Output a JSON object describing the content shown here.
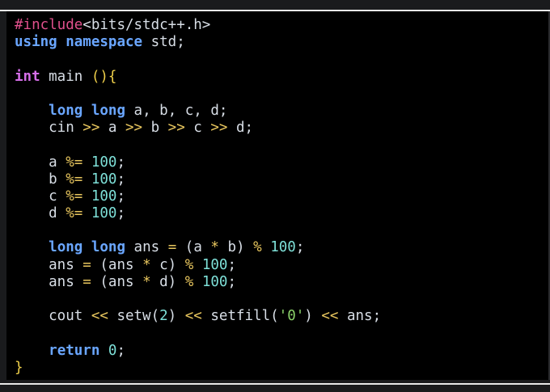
{
  "editor": {
    "lines": [
      [
        {
          "t": "#include",
          "c": "pre"
        },
        {
          "t": "<bits/stdc++.h>",
          "c": "id"
        }
      ],
      [
        {
          "t": "using",
          "c": "kw"
        },
        {
          "t": " ",
          "c": "id"
        },
        {
          "t": "namespace",
          "c": "kw"
        },
        {
          "t": " std;",
          "c": "id"
        }
      ],
      [],
      [
        {
          "t": "int",
          "c": "type"
        },
        {
          "t": " main ",
          "c": "id"
        },
        {
          "t": "(){",
          "c": "bracket"
        }
      ],
      [],
      [
        {
          "t": "    ",
          "c": "id"
        },
        {
          "t": "long",
          "c": "kw"
        },
        {
          "t": " ",
          "c": "id"
        },
        {
          "t": "long",
          "c": "kw"
        },
        {
          "t": " a, b, c, d;",
          "c": "id"
        }
      ],
      [
        {
          "t": "    cin ",
          "c": "id"
        },
        {
          "t": ">>",
          "c": "op"
        },
        {
          "t": " a ",
          "c": "id"
        },
        {
          "t": ">>",
          "c": "op"
        },
        {
          "t": " b ",
          "c": "id"
        },
        {
          "t": ">>",
          "c": "op"
        },
        {
          "t": " c ",
          "c": "id"
        },
        {
          "t": ">>",
          "c": "op"
        },
        {
          "t": " d;",
          "c": "id"
        }
      ],
      [],
      [
        {
          "t": "    a ",
          "c": "id"
        },
        {
          "t": "%=",
          "c": "op"
        },
        {
          "t": " ",
          "c": "id"
        },
        {
          "t": "100",
          "c": "num"
        },
        {
          "t": ";",
          "c": "id"
        }
      ],
      [
        {
          "t": "    b ",
          "c": "id"
        },
        {
          "t": "%=",
          "c": "op"
        },
        {
          "t": " ",
          "c": "id"
        },
        {
          "t": "100",
          "c": "num"
        },
        {
          "t": ";",
          "c": "id"
        }
      ],
      [
        {
          "t": "    c ",
          "c": "id"
        },
        {
          "t": "%=",
          "c": "op"
        },
        {
          "t": " ",
          "c": "id"
        },
        {
          "t": "100",
          "c": "num"
        },
        {
          "t": ";",
          "c": "id"
        }
      ],
      [
        {
          "t": "    d ",
          "c": "id"
        },
        {
          "t": "%=",
          "c": "op"
        },
        {
          "t": " ",
          "c": "id"
        },
        {
          "t": "100",
          "c": "num"
        },
        {
          "t": ";",
          "c": "id"
        }
      ],
      [],
      [
        {
          "t": "    ",
          "c": "id"
        },
        {
          "t": "long",
          "c": "kw"
        },
        {
          "t": " ",
          "c": "id"
        },
        {
          "t": "long",
          "c": "kw"
        },
        {
          "t": " ans ",
          "c": "id"
        },
        {
          "t": "=",
          "c": "op"
        },
        {
          "t": " (a ",
          "c": "id"
        },
        {
          "t": "*",
          "c": "op"
        },
        {
          "t": " b) ",
          "c": "id"
        },
        {
          "t": "%",
          "c": "op"
        },
        {
          "t": " ",
          "c": "id"
        },
        {
          "t": "100",
          "c": "num"
        },
        {
          "t": ";",
          "c": "id"
        }
      ],
      [
        {
          "t": "    ans ",
          "c": "id"
        },
        {
          "t": "=",
          "c": "op"
        },
        {
          "t": " (ans ",
          "c": "id"
        },
        {
          "t": "*",
          "c": "op"
        },
        {
          "t": " c) ",
          "c": "id"
        },
        {
          "t": "%",
          "c": "op"
        },
        {
          "t": " ",
          "c": "id"
        },
        {
          "t": "100",
          "c": "num"
        },
        {
          "t": ";",
          "c": "id"
        }
      ],
      [
        {
          "t": "    ans ",
          "c": "id"
        },
        {
          "t": "=",
          "c": "op"
        },
        {
          "t": " (ans ",
          "c": "id"
        },
        {
          "t": "*",
          "c": "op"
        },
        {
          "t": " d) ",
          "c": "id"
        },
        {
          "t": "%",
          "c": "op"
        },
        {
          "t": " ",
          "c": "id"
        },
        {
          "t": "100",
          "c": "num"
        },
        {
          "t": ";",
          "c": "id"
        }
      ],
      [],
      [
        {
          "t": "    cout ",
          "c": "id"
        },
        {
          "t": "<<",
          "c": "op"
        },
        {
          "t": " setw(",
          "c": "id"
        },
        {
          "t": "2",
          "c": "num"
        },
        {
          "t": ") ",
          "c": "id"
        },
        {
          "t": "<<",
          "c": "op"
        },
        {
          "t": " setfill(",
          "c": "id"
        },
        {
          "t": "'0'",
          "c": "str"
        },
        {
          "t": ") ",
          "c": "id"
        },
        {
          "t": "<<",
          "c": "op"
        },
        {
          "t": " ans;",
          "c": "id"
        }
      ],
      [],
      [
        {
          "t": "    ",
          "c": "id"
        },
        {
          "t": "return",
          "c": "kw"
        },
        {
          "t": " ",
          "c": "id"
        },
        {
          "t": "0",
          "c": "num"
        },
        {
          "t": ";",
          "c": "id"
        }
      ],
      [
        {
          "t": "}",
          "c": "bracket"
        }
      ]
    ]
  },
  "colors": {
    "background": "#000000",
    "preprocessor": "#e0508c",
    "keyword": "#6aa6ff",
    "type": "#d56ee8",
    "number": "#7ee0d8",
    "operator": "#e8c65e",
    "string": "#8bd26a",
    "text": "#d8dee6"
  }
}
